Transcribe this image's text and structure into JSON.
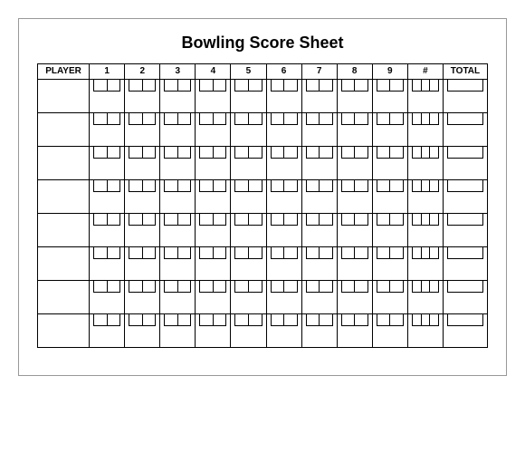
{
  "title": "Bowling Score Sheet",
  "headers": {
    "player": "PLAYER",
    "frames": [
      "1",
      "2",
      "3",
      "4",
      "5",
      "6",
      "7",
      "8",
      "9",
      "#"
    ],
    "total": "TOTAL"
  },
  "num_players": 8,
  "balls_per_frame": 2,
  "balls_tenth_frame": 3
}
